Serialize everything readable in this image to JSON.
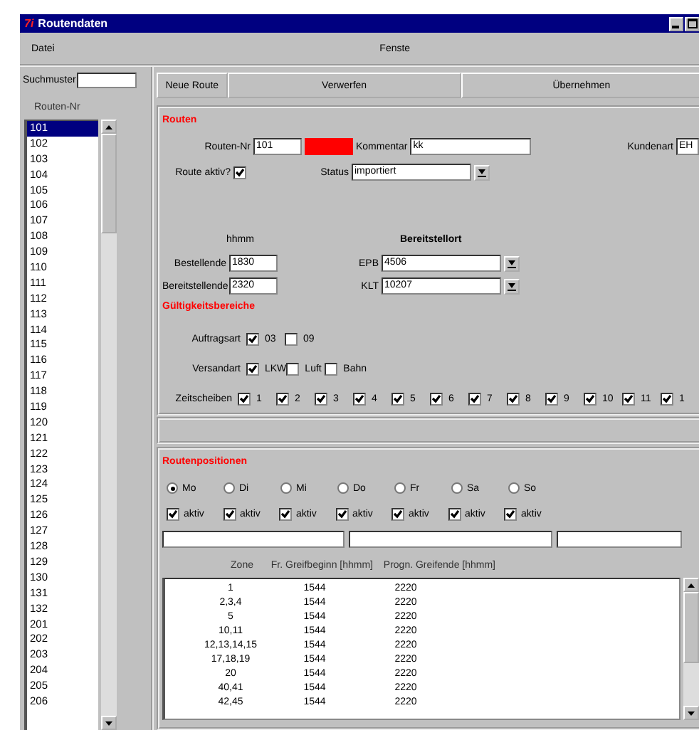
{
  "window": {
    "logo": "7i",
    "title": "Routendaten"
  },
  "menu": [
    "Datei",
    "Fenste"
  ],
  "search": {
    "label": "Suchmuster"
  },
  "route_list": {
    "header": "Routen-Nr",
    "items": [
      {
        "label": "101",
        "selected": true
      },
      {
        "label": "102",
        "selected": false
      },
      {
        "label": "103",
        "selected": false
      },
      {
        "label": "104",
        "selected": false
      },
      {
        "label": "105",
        "selected": false
      },
      {
        "label": "106",
        "selected": false
      },
      {
        "label": "107",
        "selected": false
      },
      {
        "label": "108",
        "selected": false
      },
      {
        "label": "109",
        "selected": false
      },
      {
        "label": "110",
        "selected": false
      },
      {
        "label": "111",
        "selected": false
      },
      {
        "label": "112",
        "selected": false
      },
      {
        "label": "113",
        "selected": false
      },
      {
        "label": "114",
        "selected": false
      },
      {
        "label": "115",
        "selected": false
      },
      {
        "label": "116",
        "selected": false
      },
      {
        "label": "117",
        "selected": false
      },
      {
        "label": "118",
        "selected": false
      },
      {
        "label": "119",
        "selected": false
      },
      {
        "label": "120",
        "selected": false
      },
      {
        "label": "121",
        "selected": false
      },
      {
        "label": "122",
        "selected": false
      },
      {
        "label": "123",
        "selected": false
      },
      {
        "label": "124",
        "selected": false
      },
      {
        "label": "125",
        "selected": false
      },
      {
        "label": "126",
        "selected": false
      },
      {
        "label": "127",
        "selected": false
      },
      {
        "label": "128",
        "selected": false
      },
      {
        "label": "129",
        "selected": false
      },
      {
        "label": "130",
        "selected": false
      },
      {
        "label": "131",
        "selected": false
      },
      {
        "label": "132",
        "selected": false
      },
      {
        "label": "201",
        "selected": false
      },
      {
        "label": "202",
        "selected": false
      },
      {
        "label": "203",
        "selected": false
      },
      {
        "label": "204",
        "selected": false
      },
      {
        "label": "205",
        "selected": false
      },
      {
        "label": "206",
        "selected": false
      }
    ]
  },
  "toolbar": [
    "Neue Route",
    "Verwerfen",
    "Übernehmen"
  ],
  "routen": {
    "title": "Routen",
    "routen_nr": {
      "label": "Routen-Nr",
      "value": "101"
    },
    "kommentar": {
      "label": "Kommentar",
      "value": "kk"
    },
    "kundenart": {
      "label": "Kundenart",
      "value": "EH"
    },
    "route_aktiv": {
      "label": "Route aktiv?",
      "checked": true
    },
    "status": {
      "label": "Status",
      "value": "importiert"
    },
    "hhmm_header": "hhmm",
    "bereitstellort_header": "Bereitstellort",
    "bestellende": {
      "label": "Bestellende",
      "value": "1830"
    },
    "bereitstellende": {
      "label": "Bereitstellende",
      "value": "2320"
    },
    "epb": {
      "label": "EPB",
      "value": "4506"
    },
    "klt": {
      "label": "KLT",
      "value": "10207"
    }
  },
  "gueltigkeit": {
    "title": "Gültigkeitsbereiche",
    "rows": [
      {
        "label": "Auftragsart",
        "options": [
          {
            "label": "03",
            "checked": true
          },
          {
            "label": "09",
            "checked": false
          }
        ]
      },
      {
        "label": "Versandart",
        "options": [
          {
            "label": "LKW",
            "checked": true
          },
          {
            "label": "Luft",
            "checked": false
          },
          {
            "label": "Bahn",
            "checked": false
          }
        ]
      },
      {
        "label": "Zeitscheiben",
        "options": [
          {
            "label": "1",
            "checked": true
          },
          {
            "label": "2",
            "checked": true
          },
          {
            "label": "3",
            "checked": true
          },
          {
            "label": "4",
            "checked": true
          },
          {
            "label": "5",
            "checked": true
          },
          {
            "label": "6",
            "checked": true
          },
          {
            "label": "7",
            "checked": true
          },
          {
            "label": "8",
            "checked": true
          },
          {
            "label": "9",
            "checked": true
          },
          {
            "label": "10",
            "checked": true
          },
          {
            "label": "11",
            "checked": true
          },
          {
            "label": "1",
            "checked": true
          }
        ]
      }
    ]
  },
  "positionen": {
    "title": "Routenpositionen",
    "days": [
      {
        "label": "Mo",
        "selected": true
      },
      {
        "label": "Di",
        "selected": false
      },
      {
        "label": "Mi",
        "selected": false
      },
      {
        "label": "Do",
        "selected": false
      },
      {
        "label": "Fr",
        "selected": false
      },
      {
        "label": "Sa",
        "selected": false
      },
      {
        "label": "So",
        "selected": false
      }
    ],
    "aktiv": [
      {
        "label": "aktiv",
        "checked": true
      },
      {
        "label": "aktiv",
        "checked": true
      },
      {
        "label": "aktiv",
        "checked": true
      },
      {
        "label": "aktiv",
        "checked": true
      },
      {
        "label": "aktiv",
        "checked": true
      },
      {
        "label": "aktiv",
        "checked": true
      },
      {
        "label": "aktiv",
        "checked": true
      }
    ],
    "columns": [
      "Zone",
      "Fr. Greifbeginn [hhmm]",
      "Progn. Greifende [hhmm]"
    ],
    "rows": [
      [
        "1",
        "1544",
        "2220"
      ],
      [
        "2,3,4",
        "1544",
        "2220"
      ],
      [
        "5",
        "1544",
        "2220"
      ],
      [
        "10,11",
        "1544",
        "2220"
      ],
      [
        "12,13,14,15",
        "1544",
        "2220"
      ],
      [
        "17,18,19",
        "1544",
        "2220"
      ],
      [
        "20",
        "1544",
        "2220"
      ],
      [
        "40,41",
        "1544",
        "2220"
      ],
      [
        "42,45",
        "1544",
        "2220"
      ]
    ]
  }
}
